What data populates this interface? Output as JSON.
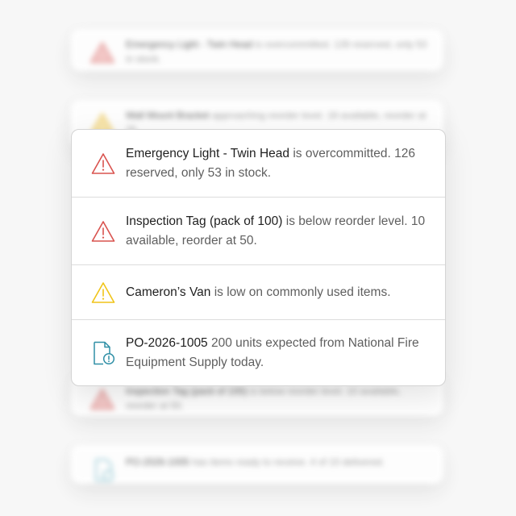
{
  "notifications": [
    {
      "icon": "warning-triangle-red-icon",
      "subject": "Emergency Light - Twin Head",
      "message": "is overcommitted. 126 reserved, only 53 in stock."
    },
    {
      "icon": "warning-triangle-red-icon",
      "subject": "Inspection Tag (pack of 100)",
      "message": "is below reorder level. 10 available, reorder at 50."
    },
    {
      "icon": "warning-triangle-yellow-icon",
      "subject": "Cameron’s Van",
      "message": "is low on commonly used items."
    },
    {
      "icon": "document-info-icon",
      "subject": "PO-2026-1005",
      "message": "200 units expected from National Fire Equipment Supply today."
    }
  ],
  "background_notifications": [
    {
      "icon": "warning-triangle-red-icon",
      "subject": "Emergency Light - Twin Head",
      "message": "is overcommitted. 126 reserved, only 53 in stock."
    },
    {
      "icon": "warning-triangle-yellow-icon",
      "subject": "Wall Mount Bracket",
      "message": "approaching reorder level. 18 available, reorder at 25."
    },
    {
      "icon": "warning-triangle-red-icon",
      "subject": "Inspection Tag (pack of 100)",
      "message": "is below reorder level. 10 available, reorder at 50."
    },
    {
      "icon": "document-info-icon",
      "subject": "PO-2026-1005",
      "message": "has items ready to receive. 4 of 10 delivered."
    }
  ],
  "colors": {
    "danger": "#d9534f",
    "warning": "#f0c419",
    "info": "#2f8fa6"
  }
}
